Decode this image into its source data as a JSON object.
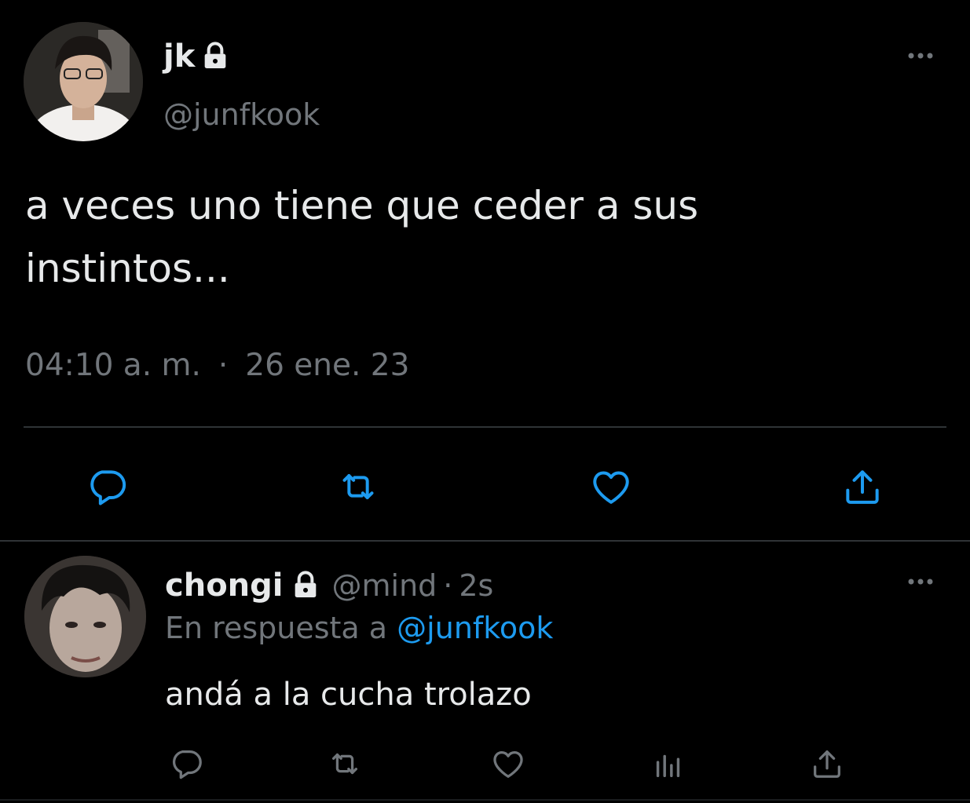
{
  "tweet": {
    "author_name": "jk",
    "author_handle": "@junfkook",
    "text": "a veces uno tiene que ceder a sus instintos...",
    "time": "04:10 a. m.",
    "separator": "·",
    "date": "26 ene. 23",
    "protected": true,
    "icons": {
      "lock": "lock-icon",
      "more": "more-icon",
      "reply": "reply-icon",
      "retweet": "retweet-icon",
      "like": "heart-icon",
      "share": "share-icon"
    }
  },
  "reply": {
    "author_name": "chongi",
    "author_handle": "@mind",
    "separator": "·",
    "time": "2s",
    "replying_prefix": "En respuesta a",
    "replying_to": "@junfkook",
    "text": "andá a la cucha trolazo",
    "protected": true,
    "icons": {
      "lock": "lock-icon",
      "more": "more-icon",
      "reply": "reply-icon",
      "retweet": "retweet-icon",
      "like": "heart-icon",
      "views": "views-icon",
      "share": "share-icon"
    }
  },
  "colors": {
    "background": "#000000",
    "text_primary": "#e7e9ea",
    "text_secondary": "#71767b",
    "link": "#1d9bf0",
    "divider": "#2f3336"
  }
}
